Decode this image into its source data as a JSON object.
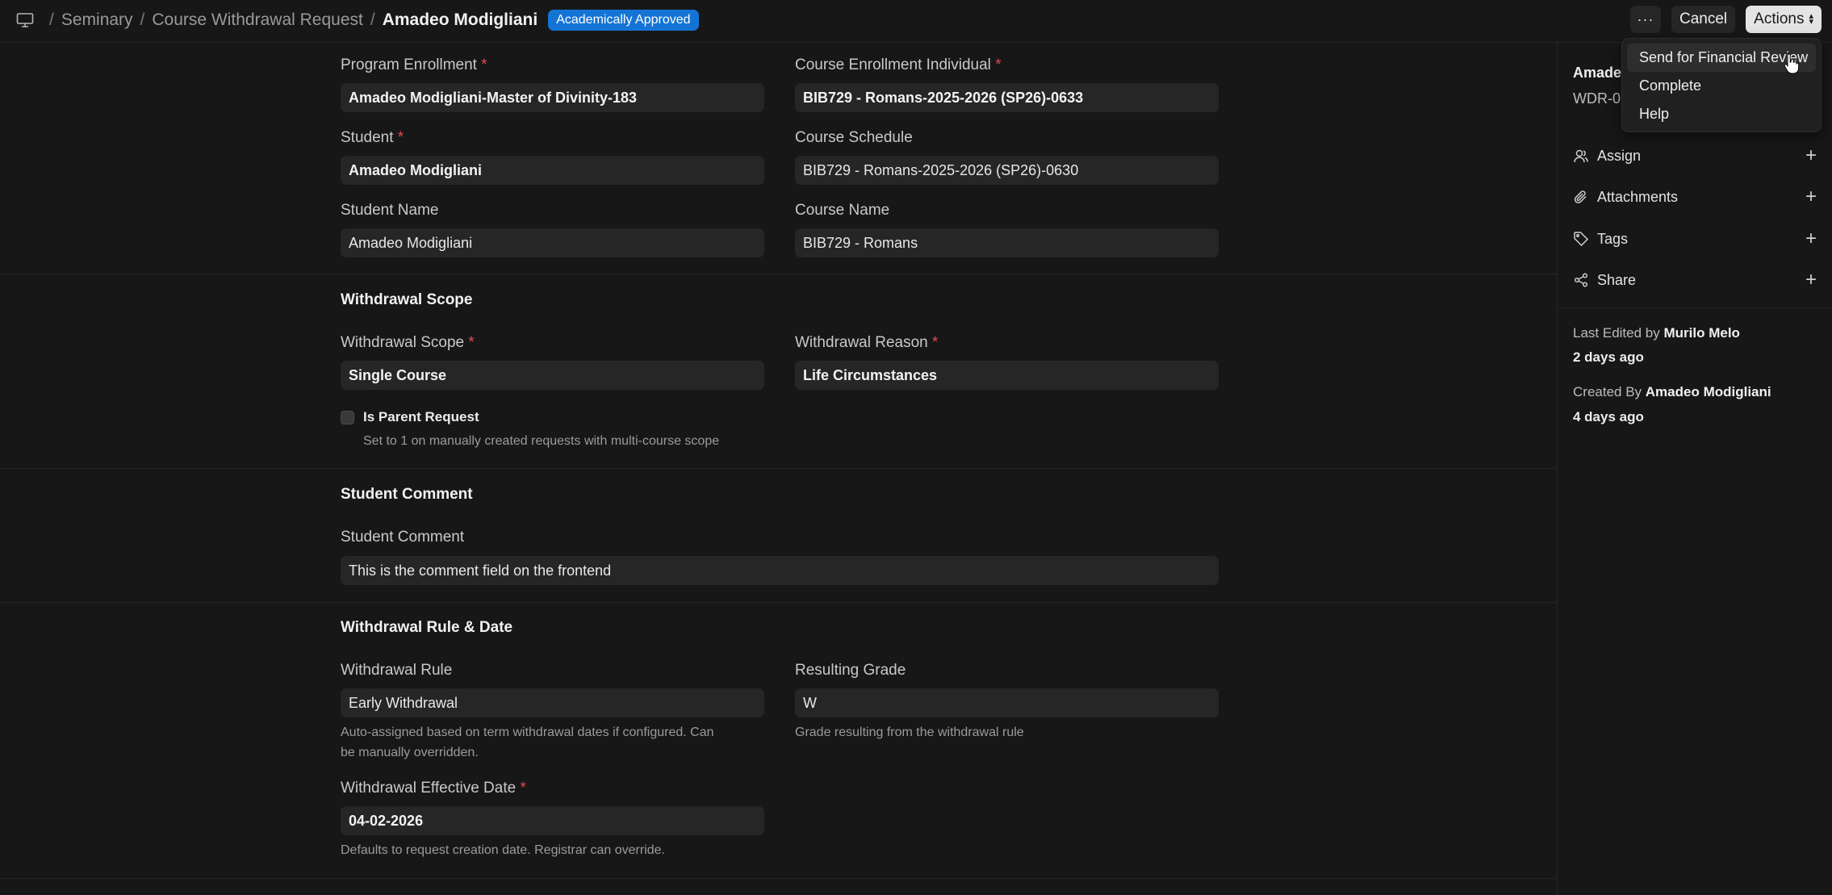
{
  "breadcrumb": {
    "items": [
      "Seminary",
      "Course Withdrawal Request"
    ],
    "current": "Amadeo Modigliani",
    "separator": "/"
  },
  "status_badge": "Academically Approved",
  "header_actions": {
    "more": "···",
    "cancel": "Cancel",
    "actions": "Actions"
  },
  "actions_menu": {
    "items": [
      "Send for Financial Review",
      "Complete",
      "Help"
    ]
  },
  "form": {
    "program_enrollment": {
      "label": "Program Enrollment",
      "required": "*",
      "value": "Amadeo Modigliani-Master of Divinity-183"
    },
    "course_enrollment_individual": {
      "label": "Course Enrollment Individual",
      "required": "*",
      "value": "BIB729 - Romans-2025-2026 (SP26)-0633"
    },
    "student": {
      "label": "Student",
      "required": "*",
      "value": "Amadeo Modigliani"
    },
    "course_schedule": {
      "label": "Course Schedule",
      "value": "BIB729 - Romans-2025-2026 (SP26)-0630"
    },
    "student_name": {
      "label": "Student Name",
      "value": "Amadeo Modigliani"
    },
    "course_name": {
      "label": "Course Name",
      "value": "BIB729 - Romans"
    },
    "scope_section": {
      "title": "Withdrawal Scope"
    },
    "withdrawal_scope": {
      "label": "Withdrawal Scope",
      "required": "*",
      "value": "Single Course"
    },
    "withdrawal_reason": {
      "label": "Withdrawal Reason",
      "required": "*",
      "value": "Life Circumstances"
    },
    "is_parent_request": {
      "label": "Is Parent Request",
      "help": "Set to 1 on manually created requests with multi-course scope",
      "checked": false
    },
    "comment_section": {
      "title": "Student Comment"
    },
    "student_comment": {
      "label": "Student Comment",
      "value": "This is the comment field on the frontend"
    },
    "rule_section": {
      "title": "Withdrawal Rule & Date"
    },
    "withdrawal_rule": {
      "label": "Withdrawal Rule",
      "value": "Early Withdrawal",
      "help_line1": "Auto-assigned based on term withdrawal dates if configured. Can",
      "help_line2": "be manually overridden."
    },
    "resulting_grade": {
      "label": "Resulting Grade",
      "value": "W",
      "help": "Grade resulting from the withdrawal rule"
    },
    "effective_date": {
      "label": "Withdrawal Effective Date",
      "required": "*",
      "value": "04-02-2026",
      "help": "Defaults to request creation date. Registrar can override."
    }
  },
  "sidebar": {
    "name": "Amade",
    "id": "WDR-0",
    "rows": [
      "Assign",
      "Attachments",
      "Tags",
      "Share"
    ],
    "last_edited_prefix": "Last Edited by",
    "last_edited_by": "Murilo Melo",
    "last_edited_ago": "2 days ago",
    "created_prefix": "Created By",
    "created_by": "Amadeo Modigliani",
    "created_ago": "4 days ago"
  },
  "colors": {
    "background": "#171717",
    "field_bg": "#262626",
    "badge": "#1474d6",
    "required": "#e5484d"
  },
  "icons": [
    "monitor-icon",
    "user-icon",
    "paperclip-icon",
    "tag-icon",
    "share-icon",
    "plus-icon",
    "cursor-hand-icon"
  ]
}
